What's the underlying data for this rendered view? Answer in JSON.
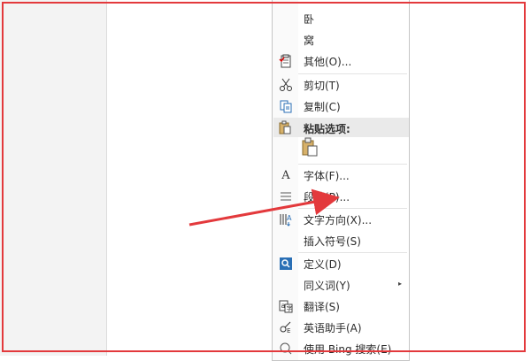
{
  "menu": {
    "top_items": [
      {
        "label": "卧"
      },
      {
        "label": "窝"
      },
      {
        "label": "其他(O)..."
      }
    ],
    "cut": {
      "label": "剪切(T)"
    },
    "copy": {
      "label": "复制(C)"
    },
    "paste_header": {
      "label": "粘贴选项:"
    },
    "font": {
      "label": "字体(F)..."
    },
    "paragraph": {
      "label": "段落(P)..."
    },
    "text_direction": {
      "label": "文字方向(X)..."
    },
    "insert_symbol": {
      "label": "插入符号(S)"
    },
    "define": {
      "label": "定义(D)"
    },
    "synonyms": {
      "label": "同义词(Y)",
      "submenu_arrow": "▸"
    },
    "translate": {
      "label": "翻译(S)"
    },
    "english_helper": {
      "label": "英语助手(A)"
    },
    "bing_search": {
      "label": "使用 Bing 搜索(E)"
    }
  },
  "annotation": {
    "frame_color": "#e3393c",
    "arrow_color": "#e3393c"
  }
}
